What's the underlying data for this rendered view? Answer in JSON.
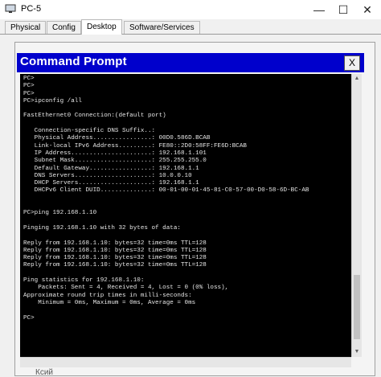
{
  "window": {
    "title": "PC-5",
    "controls": {
      "minimize": "—",
      "maximize": "☐",
      "close": "✕"
    }
  },
  "tabs": [
    {
      "label": "Physical",
      "active": false
    },
    {
      "label": "Config",
      "active": false
    },
    {
      "label": "Desktop",
      "active": true
    },
    {
      "label": "Software/Services",
      "active": false
    }
  ],
  "command_prompt": {
    "title": "Command Prompt",
    "close_label": "X",
    "lines": [
      "PC>",
      "PC>",
      "PC>",
      "PC>ipconfig /all",
      "",
      "FastEthernet0 Connection:(default port)",
      "",
      "   Connection-specific DNS Suffix..:",
      "   Physical Address................: 00D0.586D.BCAB",
      "   Link-local IPv6 Address.........: FE80::2D0:58FF:FE6D:BCAB",
      "   IP Address......................: 192.168.1.101",
      "   Subnet Mask.....................: 255.255.255.0",
      "   Default Gateway.................: 192.168.1.1",
      "   DNS Servers.....................: 10.0.0.10",
      "   DHCP Servers....................: 192.168.1.1",
      "   DHCPv6 Client DUID..............: 00-01-00-01-45-81-C0-57-00-D0-58-6D-BC-AB",
      "",
      "",
      "PC>ping 192.168.1.10",
      "",
      "Pinging 192.168.1.10 with 32 bytes of data:",
      "",
      "Reply from 192.168.1.10: bytes=32 time=0ms TTL=128",
      "Reply from 192.168.1.10: bytes=32 time=0ms TTL=128",
      "Reply from 192.168.1.10: bytes=32 time=0ms TTL=128",
      "Reply from 192.168.1.10: bytes=32 time=0ms TTL=128",
      "",
      "Ping statistics for 192.168.1.10:",
      "    Packets: Sent = 4, Received = 4, Lost = 0 (0% loss),",
      "Approximate round trip times in milli-seconds:",
      "    Minimum = 0ms, Maximum = 0ms, Average = 0ms",
      "",
      "PC>"
    ]
  },
  "scrollbar": {
    "up_arrow": "▲",
    "down_arrow": "▼"
  },
  "behind_text": "Ксий"
}
